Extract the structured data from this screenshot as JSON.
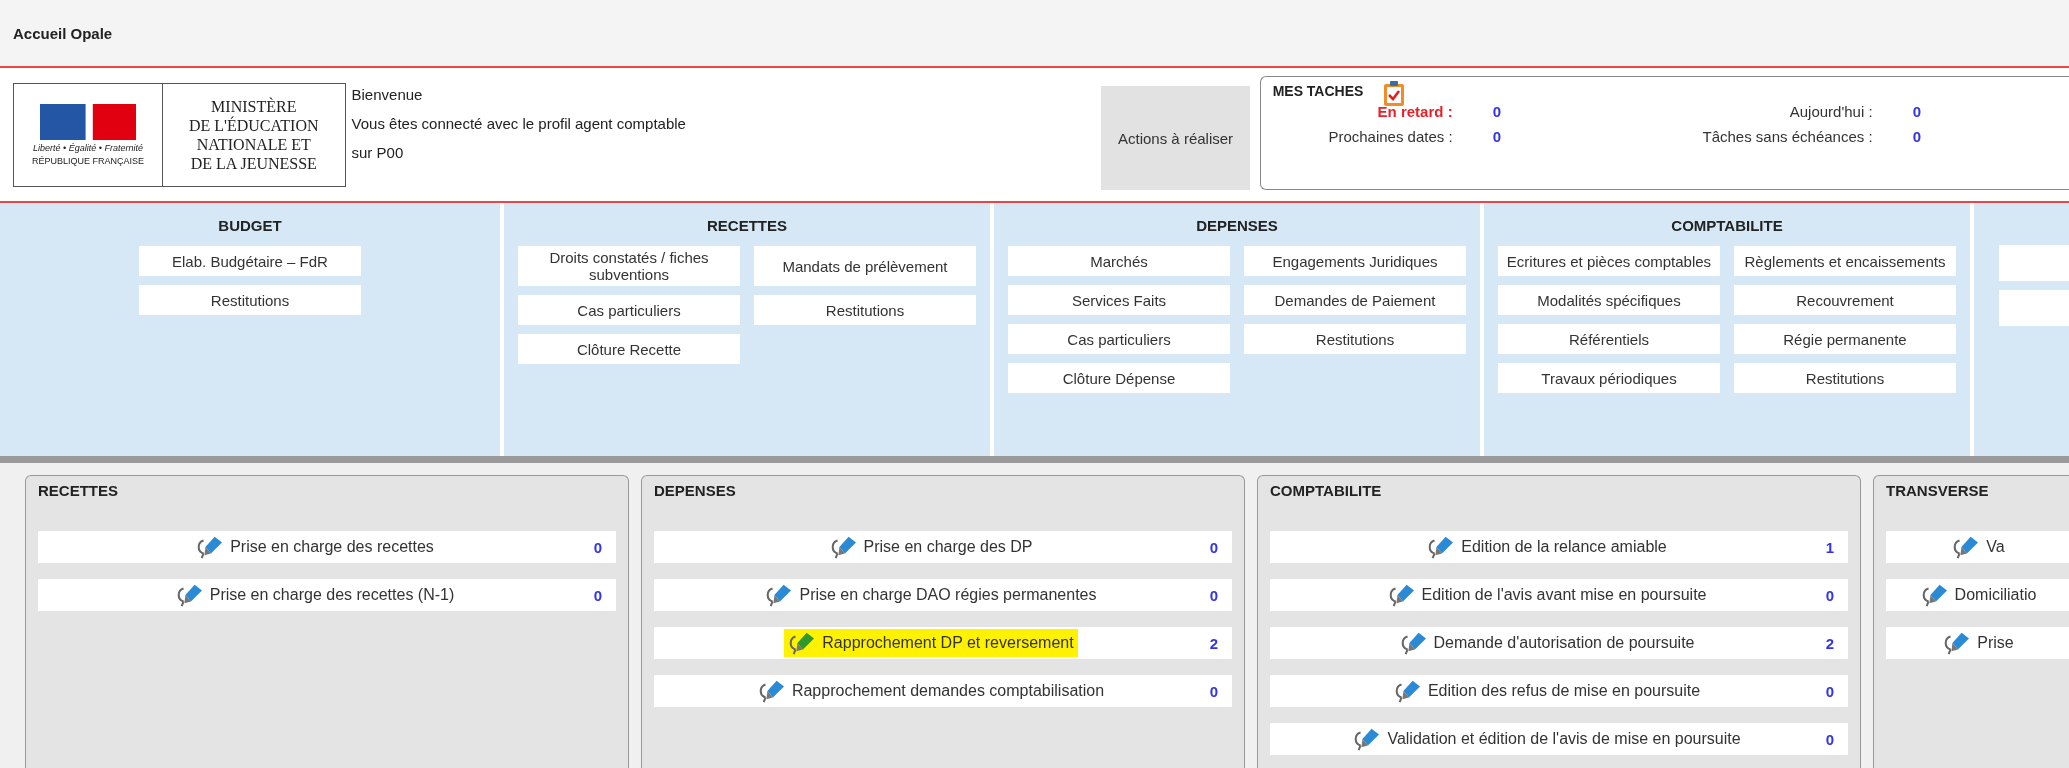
{
  "page_title": "Accueil Opale",
  "header": {
    "logo": {
      "motto": "Liberté • Égalité • Fraternité",
      "caption": "RÉPUBLIQUE FRANÇAISE",
      "ministry": [
        "MINISTÈRE",
        "DE L'ÉDUCATION",
        "NATIONALE ET",
        "DE LA JEUNESSE"
      ]
    },
    "welcome": [
      "Bienvenue",
      "Vous êtes connecté avec le profil agent comptable",
      "sur P00"
    ],
    "actions_button": "Actions à réaliser",
    "tasks": {
      "title": "MES TACHES",
      "counters": [
        {
          "label": "En retard :",
          "value": "0",
          "alert": true
        },
        {
          "label": "Aujourd'hui :",
          "value": "0",
          "alert": false
        },
        {
          "label": "Prochaines dates :",
          "value": "0",
          "alert": false
        },
        {
          "label": "Tâches sans échéances :",
          "value": "0",
          "alert": false
        }
      ]
    }
  },
  "menu": [
    {
      "heading": "BUDGET",
      "kind": "one_column",
      "items": [
        {
          "label": "Elab. Budgétaire – FdR"
        },
        {
          "label": "Restitutions"
        }
      ]
    },
    {
      "heading": "RECETTES",
      "kind": "two_columns",
      "items": [
        {
          "label": "Droits constatés / fiches subventions"
        },
        {
          "label": "Mandats de prélèvement"
        },
        {
          "label": "Cas particuliers"
        },
        {
          "label": "Restitutions"
        },
        {
          "label": "Clôture Recette"
        }
      ]
    },
    {
      "heading": "DEPENSES",
      "kind": "two_columns",
      "items": [
        {
          "label": "Marchés"
        },
        {
          "label": "Engagements Juridiques"
        },
        {
          "label": "Services Faits"
        },
        {
          "label": "Demandes de Paiement"
        },
        {
          "label": "Cas particuliers"
        },
        {
          "label": "Restitutions"
        },
        {
          "label": "Clôture Dépense"
        }
      ]
    },
    {
      "heading": "COMPTABILITE",
      "kind": "two_columns",
      "items": [
        {
          "label": "Ecritures et pièces comptables"
        },
        {
          "label": "Règlements et encaissements"
        },
        {
          "label": "Modalités spécifiques"
        },
        {
          "label": "Recouvrement"
        },
        {
          "label": "Référentiels"
        },
        {
          "label": "Régie permanente"
        },
        {
          "label": "Travaux périodiques"
        },
        {
          "label": "Restitutions"
        }
      ]
    },
    {
      "kind": "cut",
      "items": [
        {
          "kind": "blank"
        },
        {
          "kind": "blank"
        }
      ]
    }
  ],
  "panels": [
    {
      "title": "RECETTES",
      "rows": [
        {
          "label": "Prise en charge des recettes",
          "count": "0",
          "highlighted": false
        },
        {
          "label": "Prise en charge des recettes (N-1)",
          "count": "0",
          "highlighted": false
        }
      ]
    },
    {
      "title": "DEPENSES",
      "rows": [
        {
          "label": "Prise en charge des DP",
          "count": "0",
          "highlighted": false
        },
        {
          "label": "Prise en charge DAO régies permanentes",
          "count": "0",
          "highlighted": false
        },
        {
          "label": "Rapprochement DP et reversement",
          "count": "2",
          "highlighted": true
        },
        {
          "label": "Rapprochement demandes comptabilisation",
          "count": "0",
          "highlighted": false
        }
      ]
    },
    {
      "title": "COMPTABILITE",
      "rows": [
        {
          "label": "Edition de la relance amiable",
          "count": "1",
          "highlighted": false
        },
        {
          "label": "Edition de l'avis avant mise en poursuite",
          "count": "0",
          "highlighted": false
        },
        {
          "label": "Demande d'autorisation de poursuite",
          "count": "2",
          "highlighted": false
        },
        {
          "label": "Edition des refus de mise en poursuite",
          "count": "0",
          "highlighted": false
        },
        {
          "label": "Validation et édition de l'avis de mise en poursuite",
          "count": "0",
          "highlighted": false
        }
      ]
    },
    {
      "title": "TRANSVERSE",
      "rows": [
        {
          "label": "Va",
          "highlighted": false
        },
        {
          "label": "Domiciliatio",
          "highlighted": false
        },
        {
          "label": "Prise",
          "highlighted": false
        }
      ]
    }
  ]
}
